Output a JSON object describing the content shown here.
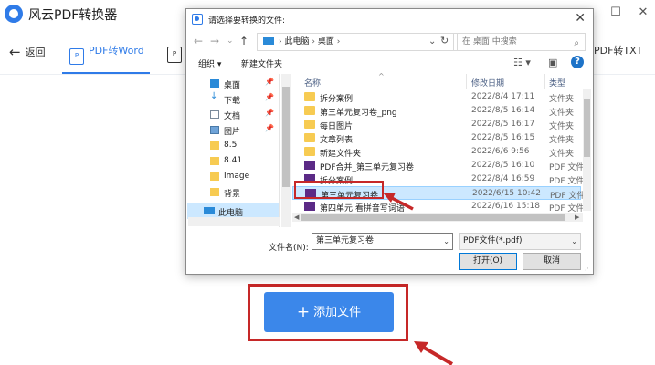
{
  "app": {
    "title": "风云PDF转换器",
    "window_controls": {
      "minimize": "—",
      "maximize": "☐",
      "close": "✕"
    }
  },
  "toolbar": {
    "back_label": "返回",
    "tabs": [
      {
        "label": "PDF转Word",
        "icon": "P",
        "active": true
      },
      {
        "label": "PDF转TXT",
        "icon": "P",
        "active": false
      }
    ]
  },
  "add_button": {
    "label": "添加文件",
    "icon": "plus-icon"
  },
  "dialog": {
    "title": "请选择要转换的文件:",
    "address": {
      "path": [
        "此电脑",
        "桌面"
      ]
    },
    "search_placeholder": "在 桌面 中搜索",
    "commands": {
      "organize": "组织 ▾",
      "new_folder": "新建文件夹"
    },
    "nav_items": [
      {
        "label": "桌面",
        "icon": "desktop-icon",
        "pinned": true,
        "selected": false
      },
      {
        "label": "下载",
        "icon": "download-icon",
        "pinned": true,
        "selected": false
      },
      {
        "label": "文档",
        "icon": "document-icon",
        "pinned": true,
        "selected": false
      },
      {
        "label": "图片",
        "icon": "picture-icon",
        "pinned": true,
        "selected": false
      },
      {
        "label": "8.5",
        "icon": "folder-icon",
        "pinned": false,
        "selected": false
      },
      {
        "label": "8.41",
        "icon": "folder-icon",
        "pinned": false,
        "selected": false
      },
      {
        "label": "Image",
        "icon": "folder-icon",
        "pinned": false,
        "selected": false
      },
      {
        "label": "背景",
        "icon": "folder-icon",
        "pinned": false,
        "selected": false
      },
      {
        "label": "此电脑",
        "icon": "computer-icon",
        "pinned": false,
        "selected": true
      }
    ],
    "columns": {
      "name": "名称",
      "date": "修改日期",
      "type": "类型"
    },
    "files": [
      {
        "name": "拆分案例",
        "date": "2022/8/4 17:11",
        "type": "文件夹",
        "kind": "folder",
        "selected": false
      },
      {
        "name": "第三单元复习卷_png",
        "date": "2022/8/5 16:14",
        "type": "文件夹",
        "kind": "folder",
        "selected": false
      },
      {
        "name": "每日图片",
        "date": "2022/8/5 16:17",
        "type": "文件夹",
        "kind": "folder",
        "selected": false
      },
      {
        "name": "文章列表",
        "date": "2022/8/5 16:15",
        "type": "文件夹",
        "kind": "folder",
        "selected": false
      },
      {
        "name": "新建文件夹",
        "date": "2022/6/6 9:56",
        "type": "文件夹",
        "kind": "folder",
        "selected": false
      },
      {
        "name": "PDF合并_第三单元复习卷",
        "date": "2022/8/5 16:10",
        "type": "PDF 文件",
        "kind": "pdf",
        "selected": false
      },
      {
        "name": "拆分案例",
        "date": "2022/8/4 16:59",
        "type": "PDF 文件",
        "kind": "pdf",
        "selected": false
      },
      {
        "name": "第三单元复习卷",
        "date": "2022/6/15 10:42",
        "type": "PDF 文件",
        "kind": "pdf",
        "selected": true
      },
      {
        "name": "第四单元 看拼音写词语",
        "date": "2022/6/16 15:18",
        "type": "PDF 文件",
        "kind": "pdf",
        "selected": false
      }
    ],
    "filename_label": "文件名(N):",
    "filename_value": "第三单元复习卷",
    "filetype_value": "PDF文件(*.pdf)",
    "open_label": "打开(O)",
    "cancel_label": "取消"
  },
  "colors": {
    "accent": "#2f7be8",
    "add_button": "#3b87ea",
    "annotation": "#c62828",
    "selection": "#cce8ff",
    "folder": "#f7cb52",
    "pdf": "#5b2a86"
  }
}
